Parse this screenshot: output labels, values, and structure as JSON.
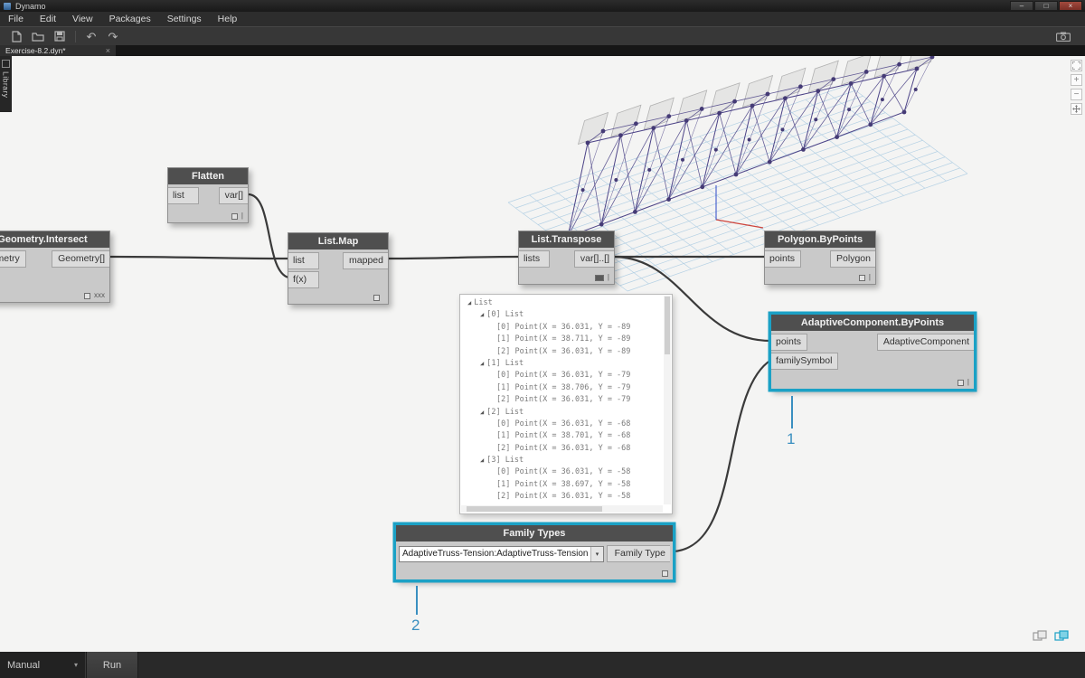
{
  "window": {
    "title": "Dynamo",
    "controls": {
      "minimize": "–",
      "maximize": "□",
      "close": "×"
    }
  },
  "menu": {
    "items": [
      "File",
      "Edit",
      "View",
      "Packages",
      "Settings",
      "Help"
    ]
  },
  "tabs": {
    "active": "Exercise-8.2.dyn*",
    "close_icon": "×"
  },
  "library": {
    "label": "Library"
  },
  "canvas_controls": {
    "zoom_in": "+",
    "zoom_out": "−"
  },
  "toolbar": {
    "undo_icon": "↶",
    "redo_icon": "↷"
  },
  "nodes": {
    "flatten": {
      "title": "Flatten",
      "in1": "list",
      "out1": "var[]",
      "lacing": "|"
    },
    "geometry_intersect": {
      "title": "Geometry.Intersect",
      "in1": "geometry",
      "out1": "Geometry[]",
      "lacing": "xxx"
    },
    "list_map": {
      "title": "List.Map",
      "in1": "list",
      "in2": "f(x)",
      "out1": "mapped",
      "lacing": ""
    },
    "list_transpose": {
      "title": "List.Transpose",
      "in1": "lists",
      "out1": "var[]..[]",
      "lacing": "|"
    },
    "polygon_bypoints": {
      "title": "Polygon.ByPoints",
      "in1": "points",
      "out1": "Polygon",
      "lacing": "|"
    },
    "adaptive_component": {
      "title": "AdaptiveComponent.ByPoints",
      "in1": "points",
      "in2": "familySymbol",
      "out1": "AdaptiveComponent",
      "lacing": "|"
    },
    "family_types": {
      "title": "Family Types",
      "dropdown": "AdaptiveTruss-Tension:AdaptiveTruss-Tension",
      "dropdown_arrow": "▾",
      "out1": "Family Type"
    }
  },
  "watch": {
    "lines": [
      {
        "e": 1,
        "i": 0,
        "t": "List"
      },
      {
        "e": 1,
        "i": 1,
        "t": "[0] List"
      },
      {
        "e": 0,
        "i": 2,
        "t": "[0] Point(X = 36.031, Y = -89"
      },
      {
        "e": 0,
        "i": 2,
        "t": "[1] Point(X = 38.711, Y = -89"
      },
      {
        "e": 0,
        "i": 2,
        "t": "[2] Point(X = 36.031, Y = -89"
      },
      {
        "e": 1,
        "i": 1,
        "t": "[1] List"
      },
      {
        "e": 0,
        "i": 2,
        "t": "[0] Point(X = 36.031, Y = -79"
      },
      {
        "e": 0,
        "i": 2,
        "t": "[1] Point(X = 38.706, Y = -79"
      },
      {
        "e": 0,
        "i": 2,
        "t": "[2] Point(X = 36.031, Y = -79"
      },
      {
        "e": 1,
        "i": 1,
        "t": "[2] List"
      },
      {
        "e": 0,
        "i": 2,
        "t": "[0] Point(X = 36.031, Y = -68"
      },
      {
        "e": 0,
        "i": 2,
        "t": "[1] Point(X = 38.701, Y = -68"
      },
      {
        "e": 0,
        "i": 2,
        "t": "[2] Point(X = 36.031, Y = -68"
      },
      {
        "e": 1,
        "i": 1,
        "t": "[3] List"
      },
      {
        "e": 0,
        "i": 2,
        "t": "[0] Point(X = 36.031, Y = -58"
      },
      {
        "e": 0,
        "i": 2,
        "t": "[1] Point(X = 38.697, Y = -58"
      },
      {
        "e": 0,
        "i": 2,
        "t": "[2] Point(X = 36.031, Y = -58"
      }
    ]
  },
  "annotations": {
    "n1": "1",
    "n2": "2"
  },
  "run_bar": {
    "mode": "Manual",
    "mode_arrow": "▾",
    "run": "Run"
  },
  "colors": {
    "selection": "#1ba1c5",
    "wire": "#3a3a3a",
    "annotation": "#3a8fc0",
    "grid_line": "#b3d0e4",
    "truss": "#4c4387",
    "truss_dot": "#453b76"
  }
}
